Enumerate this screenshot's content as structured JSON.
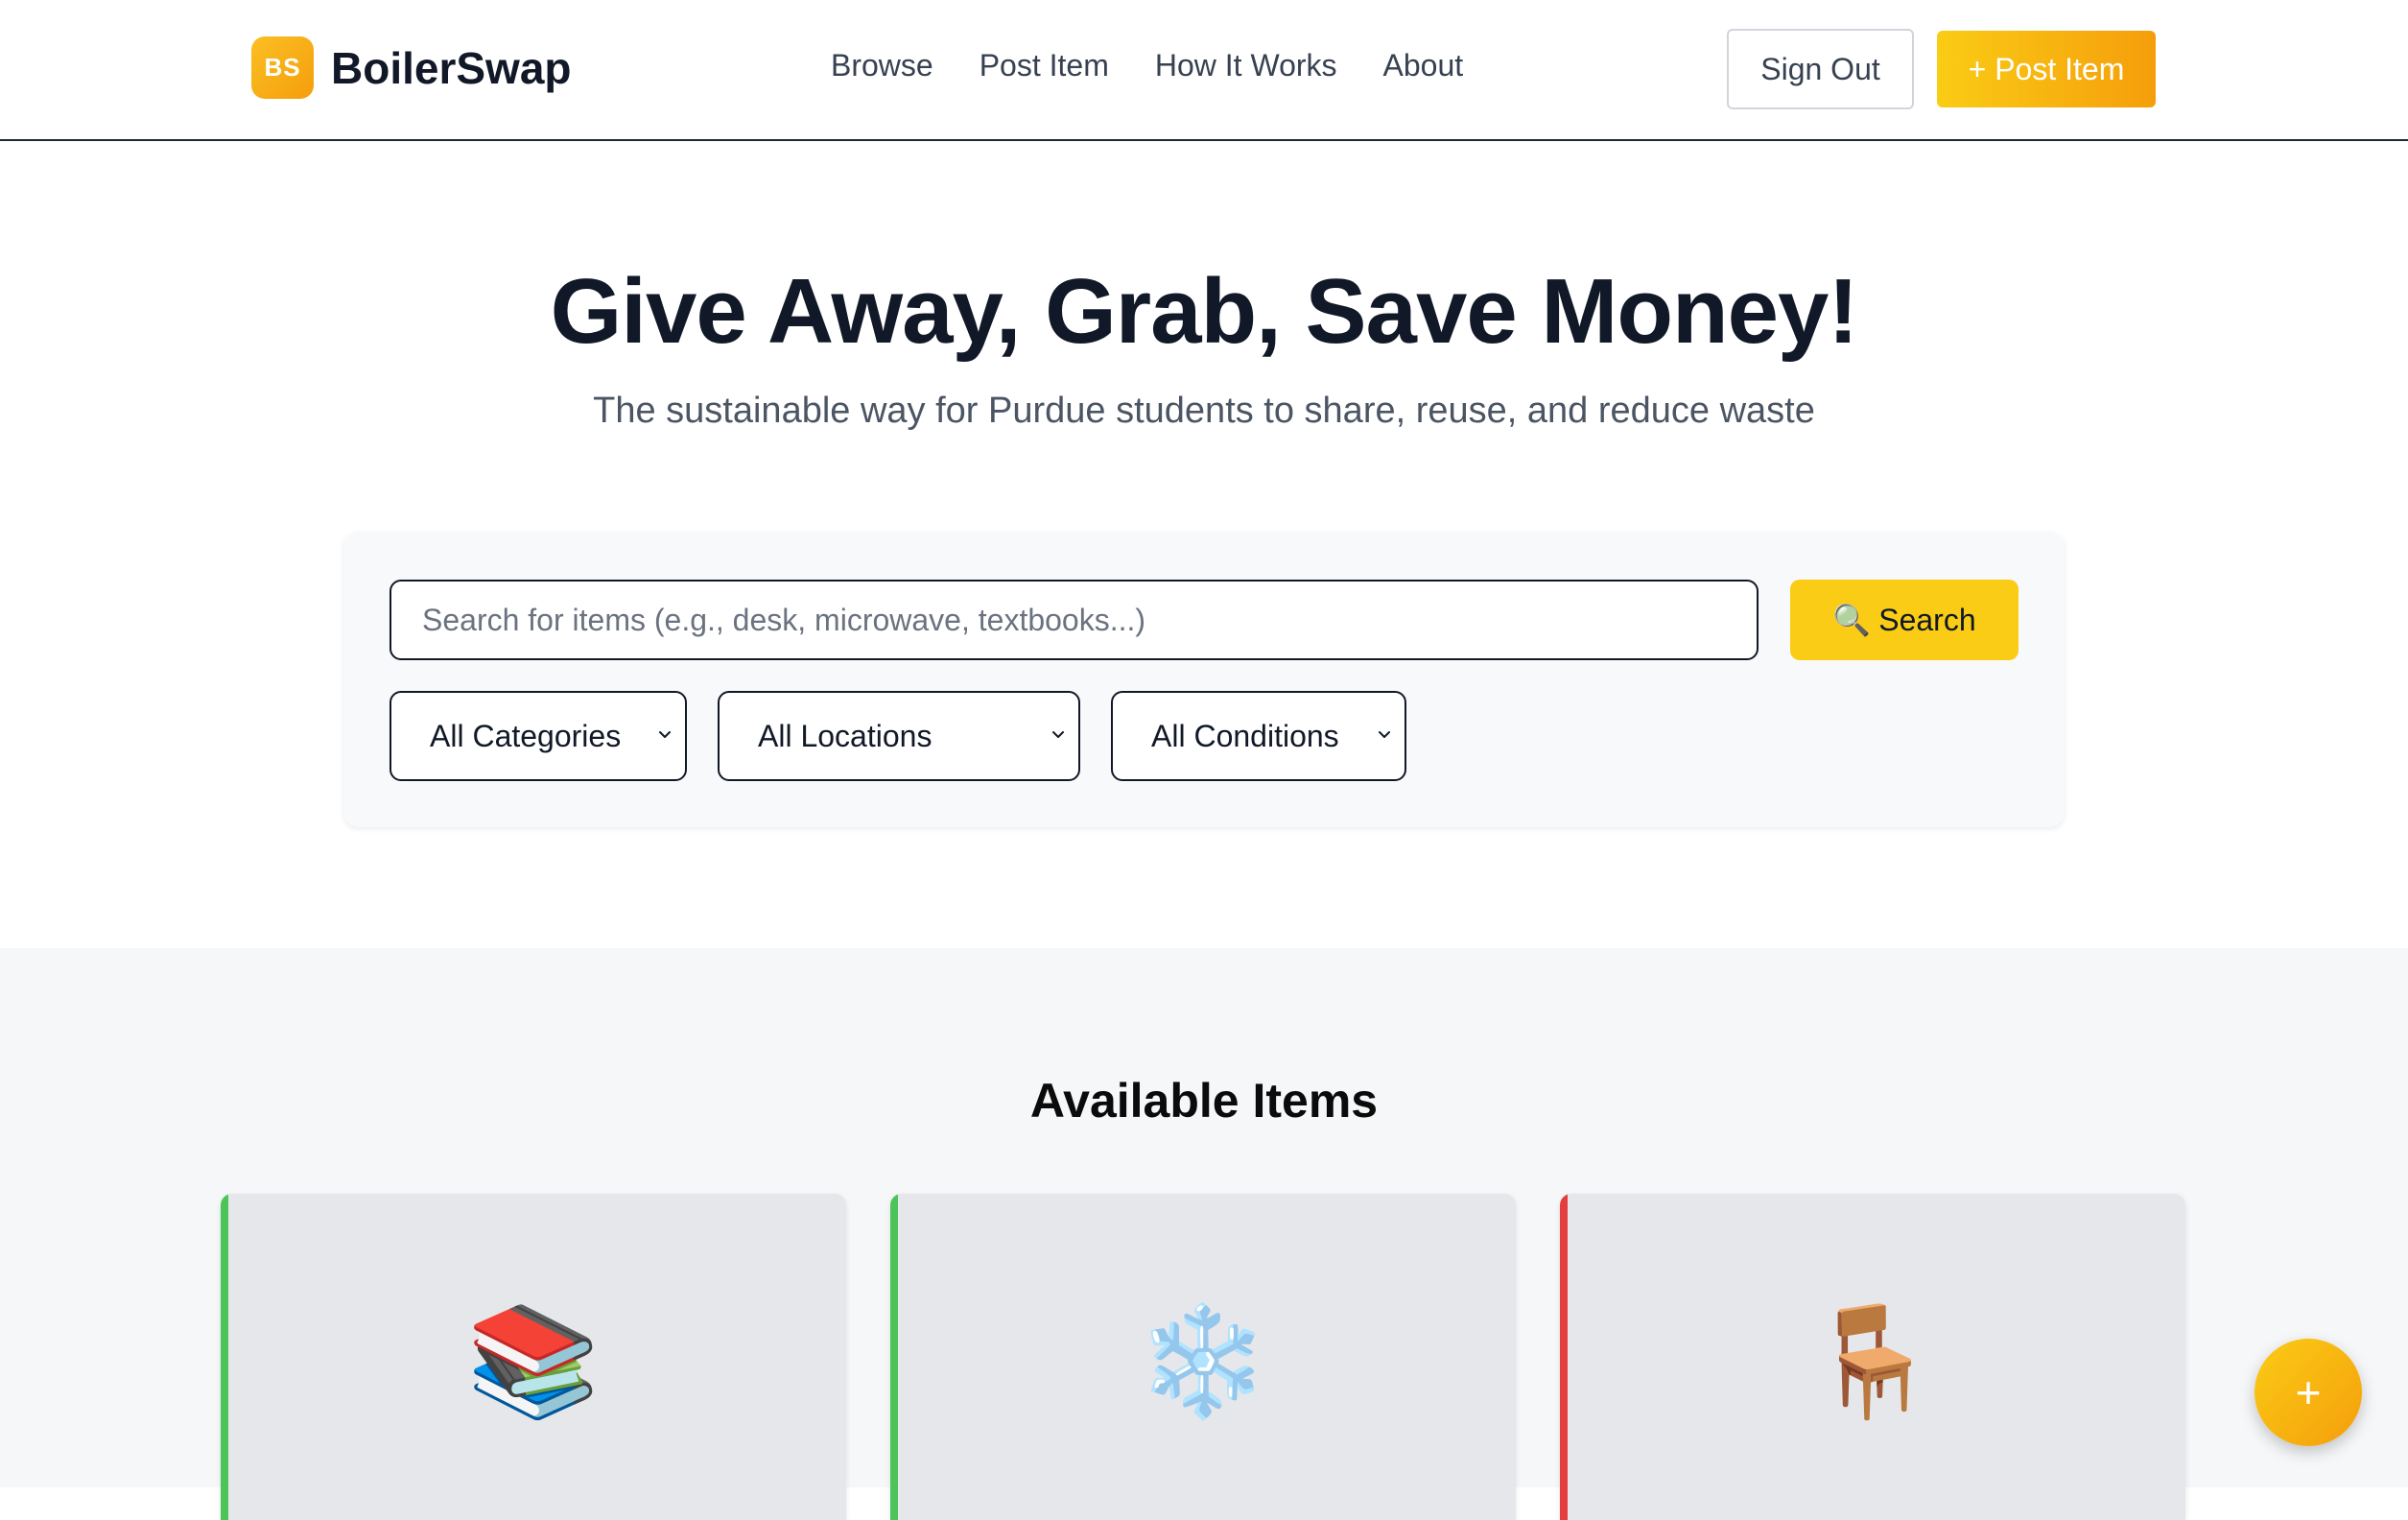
{
  "brand": {
    "badge": "BS",
    "name": "BoilerSwap",
    "accent": "#facc15"
  },
  "nav": {
    "items": [
      {
        "label": "Browse"
      },
      {
        "label": "Post Item"
      },
      {
        "label": "How It Works"
      },
      {
        "label": "About"
      }
    ]
  },
  "header_actions": {
    "sign_out_label": "Sign Out",
    "post_item_label": "+ Post Item"
  },
  "hero": {
    "title": "Give Away, Grab, Save Money!",
    "subtitle": "The sustainable way for Purdue students to share, reuse, and reduce waste"
  },
  "search": {
    "placeholder": "Search for items (e.g., desk, microwave, textbooks...)",
    "value": "",
    "button_icon": "🔍",
    "button_label": "Search"
  },
  "filters": {
    "category": "All Categories",
    "location": "All Locations",
    "condition": "All Conditions"
  },
  "items_section": {
    "title": "Available Items",
    "cards": [
      {
        "icon": "📚",
        "icon_name": "books-icon",
        "accent": "#4cc45a"
      },
      {
        "icon": "❄️",
        "icon_name": "snowflake-icon",
        "accent": "#4cc45a"
      },
      {
        "icon": "🪑",
        "icon_name": "chair-icon",
        "accent": "#e53e3e"
      }
    ]
  },
  "fab": {
    "label": "+"
  }
}
